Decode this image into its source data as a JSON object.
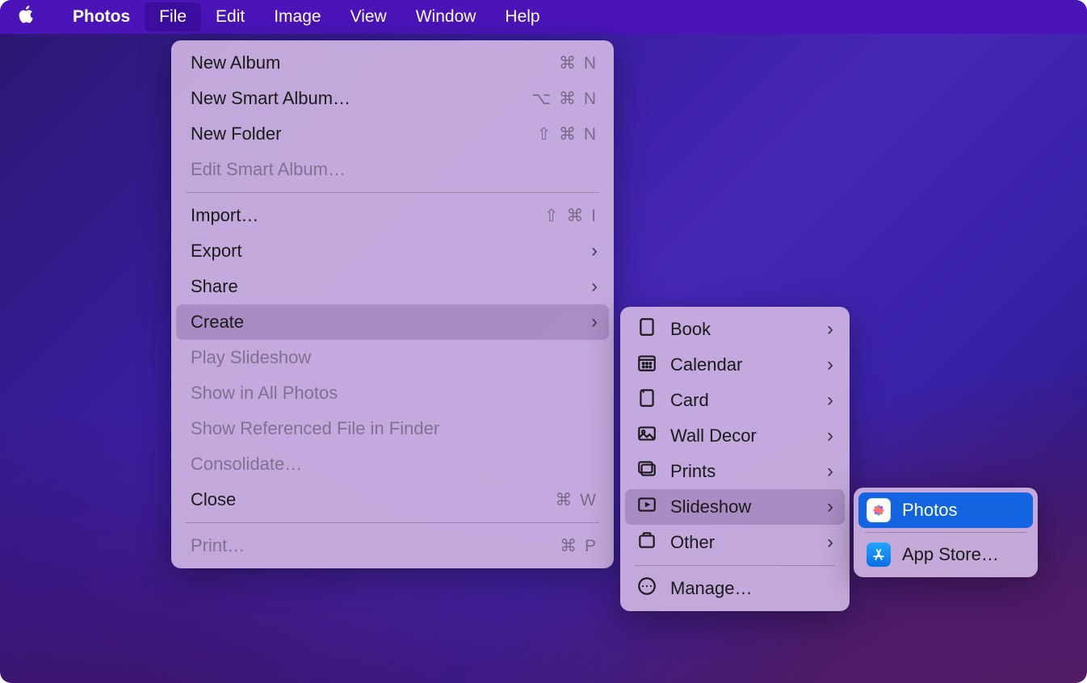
{
  "menubar": {
    "app_name": "Photos",
    "items": [
      "File",
      "Edit",
      "Image",
      "View",
      "Window",
      "Help"
    ],
    "selected_index": 0
  },
  "file_menu": {
    "items": [
      {
        "label": "New Album",
        "shortcut": "⌘ N",
        "enabled": true
      },
      {
        "label": "New Smart Album…",
        "shortcut": "⌥ ⌘ N",
        "enabled": true
      },
      {
        "label": "New Folder",
        "shortcut": "⇧ ⌘ N",
        "enabled": true
      },
      {
        "label": "Edit Smart Album…",
        "shortcut": "",
        "enabled": false
      }
    ],
    "items2": [
      {
        "label": "Import…",
        "shortcut": "⇧ ⌘ I",
        "enabled": true
      },
      {
        "label": "Export",
        "shortcut": "",
        "submenu": true,
        "enabled": true
      },
      {
        "label": "Share",
        "shortcut": "",
        "submenu": true,
        "enabled": true
      },
      {
        "label": "Create",
        "shortcut": "",
        "submenu": true,
        "enabled": true,
        "highlight": true
      },
      {
        "label": "Play Slideshow",
        "shortcut": "",
        "enabled": false
      },
      {
        "label": "Show in All Photos",
        "shortcut": "",
        "enabled": false
      },
      {
        "label": "Show Referenced File in Finder",
        "shortcut": "",
        "enabled": false
      },
      {
        "label": "Consolidate…",
        "shortcut": "",
        "enabled": false
      },
      {
        "label": "Close",
        "shortcut": "⌘ W",
        "enabled": true
      }
    ],
    "items3": [
      {
        "label": "Print…",
        "shortcut": "⌘ P",
        "enabled": false
      }
    ]
  },
  "create_submenu": {
    "items": [
      {
        "label": "Book",
        "icon": "book-icon",
        "submenu": true
      },
      {
        "label": "Calendar",
        "icon": "calendar-icon",
        "submenu": true
      },
      {
        "label": "Card",
        "icon": "card-icon",
        "submenu": true
      },
      {
        "label": "Wall Decor",
        "icon": "walldecor-icon",
        "submenu": true
      },
      {
        "label": "Prints",
        "icon": "prints-icon",
        "submenu": true
      },
      {
        "label": "Slideshow",
        "icon": "slideshow-icon",
        "submenu": true,
        "highlight": true
      },
      {
        "label": "Other",
        "icon": "other-icon",
        "submenu": true
      }
    ],
    "manage_label": "Manage…"
  },
  "slideshow_submenu": {
    "items": [
      {
        "label": "Photos",
        "icon": "photos-app-icon",
        "selected": true
      },
      {
        "label": "App Store…",
        "icon": "appstore-app-icon",
        "selected": false
      }
    ]
  }
}
